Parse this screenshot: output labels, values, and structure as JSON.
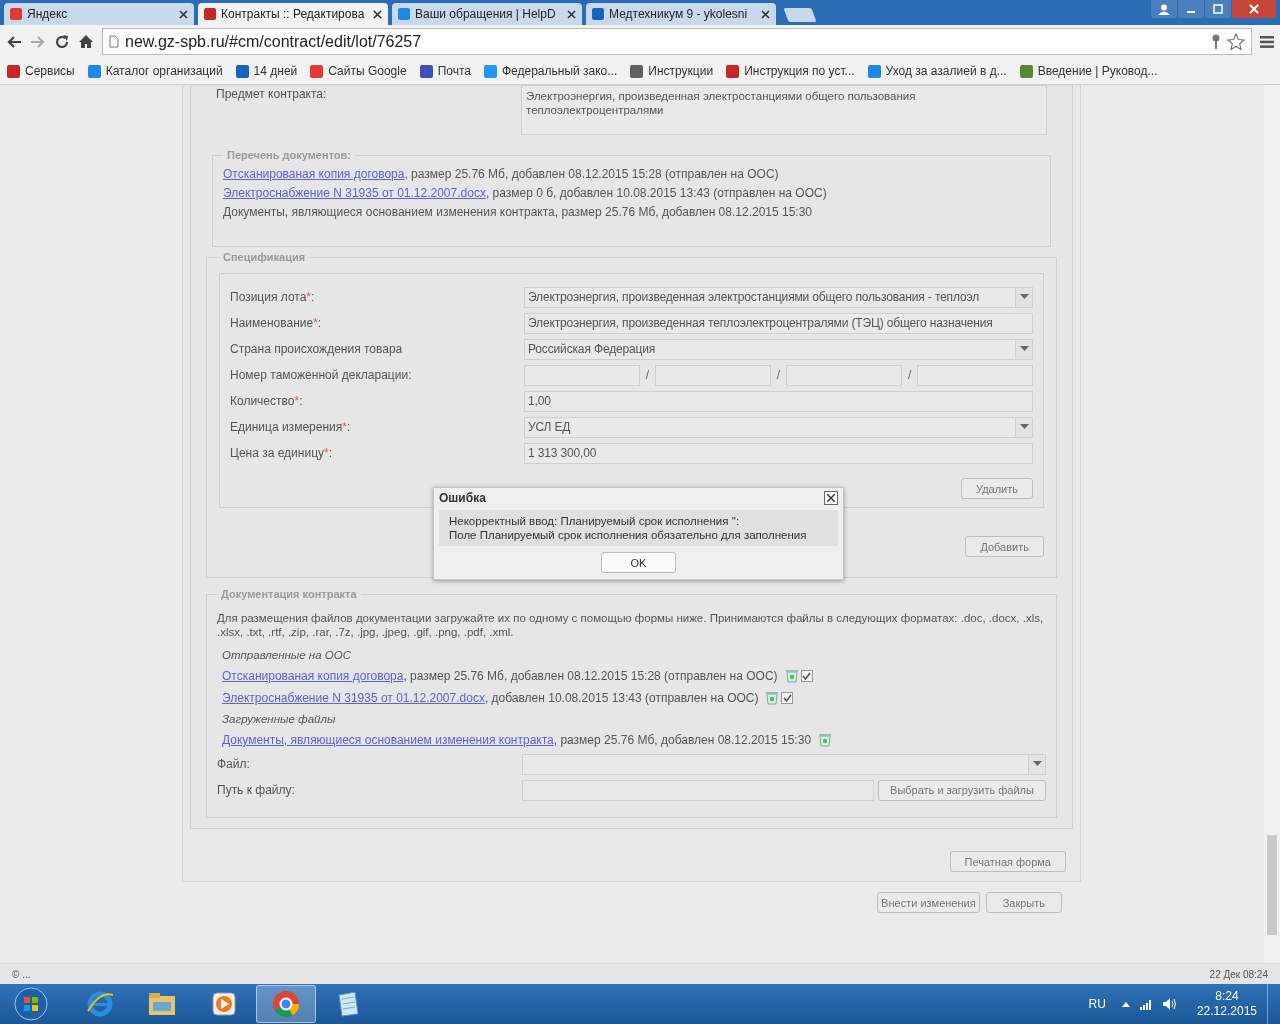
{
  "browser": {
    "tabs": [
      {
        "title": "Яндекс",
        "selected": false
      },
      {
        "title": "Контракты :: Редактирова",
        "selected": true
      },
      {
        "title": "Ваши обращения | HelpD",
        "selected": false
      },
      {
        "title": "Медтехникум 9 - ykolesni",
        "selected": false
      }
    ],
    "url": "new.gz-spb.ru/#cm/contract/edit/lot/76257",
    "bookmarks": [
      {
        "label": "Сервисы"
      },
      {
        "label": "Каталог организаций"
      },
      {
        "label": "14 дней"
      },
      {
        "label": "Сайты Google"
      },
      {
        "label": "Почта"
      },
      {
        "label": "Федеральный зако..."
      },
      {
        "label": "Инструкции"
      },
      {
        "label": "Инструкция по уст..."
      },
      {
        "label": "Уход за азалией в д..."
      },
      {
        "label": "Введение | Руковод..."
      }
    ]
  },
  "subject": {
    "label": "Предмет контракта:",
    "value": "Электроэнергия, произведенная электростанциями общего пользования теплоэлектроцентралями"
  },
  "documents_list": {
    "legend": "Перечень документов:",
    "items": [
      {
        "link": "Отсканированая копия договора",
        "details": ", размер 25.76 Мб, добавлен 08.12.2015 15:28 (отправлен на ООС)"
      },
      {
        "link": "Электроснабжение N 31935 от 01.12.2007.docx",
        "details": ", размер 0 б, добавлен 10.08.2015 13:43 (отправлен на ООС)"
      },
      {
        "details": "Документы, являющиеся основанием изменения контракта, размер 25.76 Мб, добавлен 08.12.2015 15:30"
      }
    ]
  },
  "specification": {
    "legend": "Спецификация",
    "fields": [
      {
        "kind": "select",
        "label": "Позиция лота",
        "mark": "*",
        "suffix": ":",
        "value": "Электроэнергия, произведенная электростанциями общего пользования - теплоэл"
      },
      {
        "kind": "input",
        "label": "Наименование",
        "mark": "*",
        "suffix": ":",
        "value": "Электроэнергия, произведенная теплоэлектроцентралями (ТЭЦ) общего назначения"
      },
      {
        "kind": "select",
        "label": "Страна происхождения товара",
        "value": "Российская Федерация"
      },
      {
        "kind": "split",
        "label": "Номер таможенной декларации:",
        "separator": "/"
      },
      {
        "kind": "input",
        "label": "Количество",
        "mark": "*",
        "suffix": ":",
        "value": "1,00"
      },
      {
        "kind": "select",
        "label": "Единица измерения",
        "mark": "*",
        "suffix": ":",
        "value": "УСЛ ЕД"
      },
      {
        "kind": "input",
        "label": "Цена за единицу",
        "mark": "*",
        "suffix": ":",
        "value": "1 313 300,00"
      }
    ],
    "delete_button": "Удалить",
    "add_button": "Добавить"
  },
  "contract_docs": {
    "legend": "Документация контракта",
    "note": "Для размещения файлов документации загружайте их по одному с помощью формы ниже. Принимаются файлы в следующих форматах: .doc, .docx, .xls, .xlsx, .txt, .rtf, .zip, .rar, .7z, .jpg, .jpeg, .gif, .png, .pdf, .xml.",
    "sent_heading": "Отправленные на ООС",
    "sent": [
      {
        "link": "Отсканированая копия договора",
        "details": ", размер 25.76 Мб, добавлен 08.12.2015 15:28 (отправлен на ООС)",
        "checked": true
      },
      {
        "link": "Электроснабжение N 31935 от 01.12.2007.docx",
        "details": ", добавлен 10.08.2015 13:43 (отправлен на ООС)",
        "checked": true
      }
    ],
    "uploaded_heading": "Загруженные файлы",
    "uploaded": [
      {
        "link": "Документы, являющиеся основанием изменения контракта",
        "details": ", размер 25.76 Мб, добавлен 08.12.2015 15:30"
      }
    ],
    "file_label": "Файл:",
    "path_label": "Путь к файлу:",
    "upload_button": "Выбрать и загрузить файлы"
  },
  "print_button": "Печатная форма",
  "actions": [
    "Внести изменения",
    "Закрыть"
  ],
  "dialog": {
    "title": "Ошибка",
    "lines": [
      "Некорректный ввод: Планируемый срок исполнения '':",
      "Поле Планируемый срок исполнения обязательно для заполнения"
    ],
    "ok": "OK"
  },
  "status_bar": {
    "left": "© ...",
    "right": "22 Дек 08:24"
  },
  "taskbar": {
    "apps": [
      {
        "kind": "ie",
        "selected": false
      },
      {
        "kind": "explorer",
        "selected": false
      },
      {
        "kind": "media",
        "selected": false
      },
      {
        "kind": "chrome",
        "selected": true
      },
      {
        "kind": "notepad",
        "selected": false
      }
    ],
    "language": "RU",
    "time": "8:24",
    "date": "22.12.2015"
  }
}
